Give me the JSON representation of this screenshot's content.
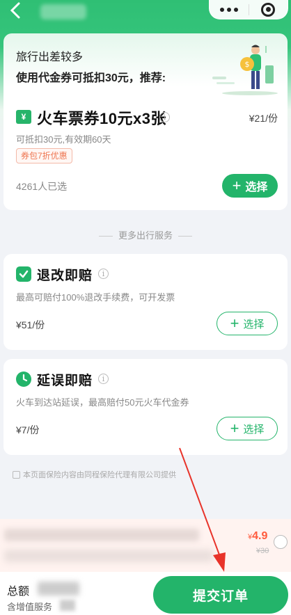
{
  "nav": {
    "back_icon": "chevron-left-icon",
    "more_icon": "more-dots-icon",
    "close_icon": "close-circle-icon"
  },
  "promo": {
    "line1": "旅行出差较多",
    "line2": "使用代金券可抵扣30元，推荐:"
  },
  "ticket": {
    "icon_text": "¥",
    "title": "火车票券10元x3张",
    "price": "¥21/份",
    "desc": "可抵扣30元,有效期60天",
    "badge": "券包7折优惠",
    "count": "4261人已选",
    "button_label": "选择"
  },
  "divider": "更多出行服务",
  "services": [
    {
      "title": "退改即赔",
      "desc": "最高可赔付100%退改手续费，可开发票",
      "price": "¥51/份",
      "button_label": "选择",
      "color": "#23b46a"
    },
    {
      "title": "延误即赔",
      "desc": "火车到达站延误，最高赔付50元火车代金券",
      "price": "¥7/份",
      "button_label": "选择",
      "color": "#23b46a"
    }
  ],
  "footnote": "本页面保险内容由同程保险代理有限公司提供",
  "addon": {
    "price_symbol": "¥",
    "price": "4.9",
    "old_price": "¥30"
  },
  "bottom": {
    "total_label": "总额",
    "sub_label": "含增值服务",
    "submit_label": "提交订单"
  },
  "colors": {
    "brand": "#23b46a",
    "accent_red": "#ff5a3c",
    "badge": "#ee7651"
  }
}
